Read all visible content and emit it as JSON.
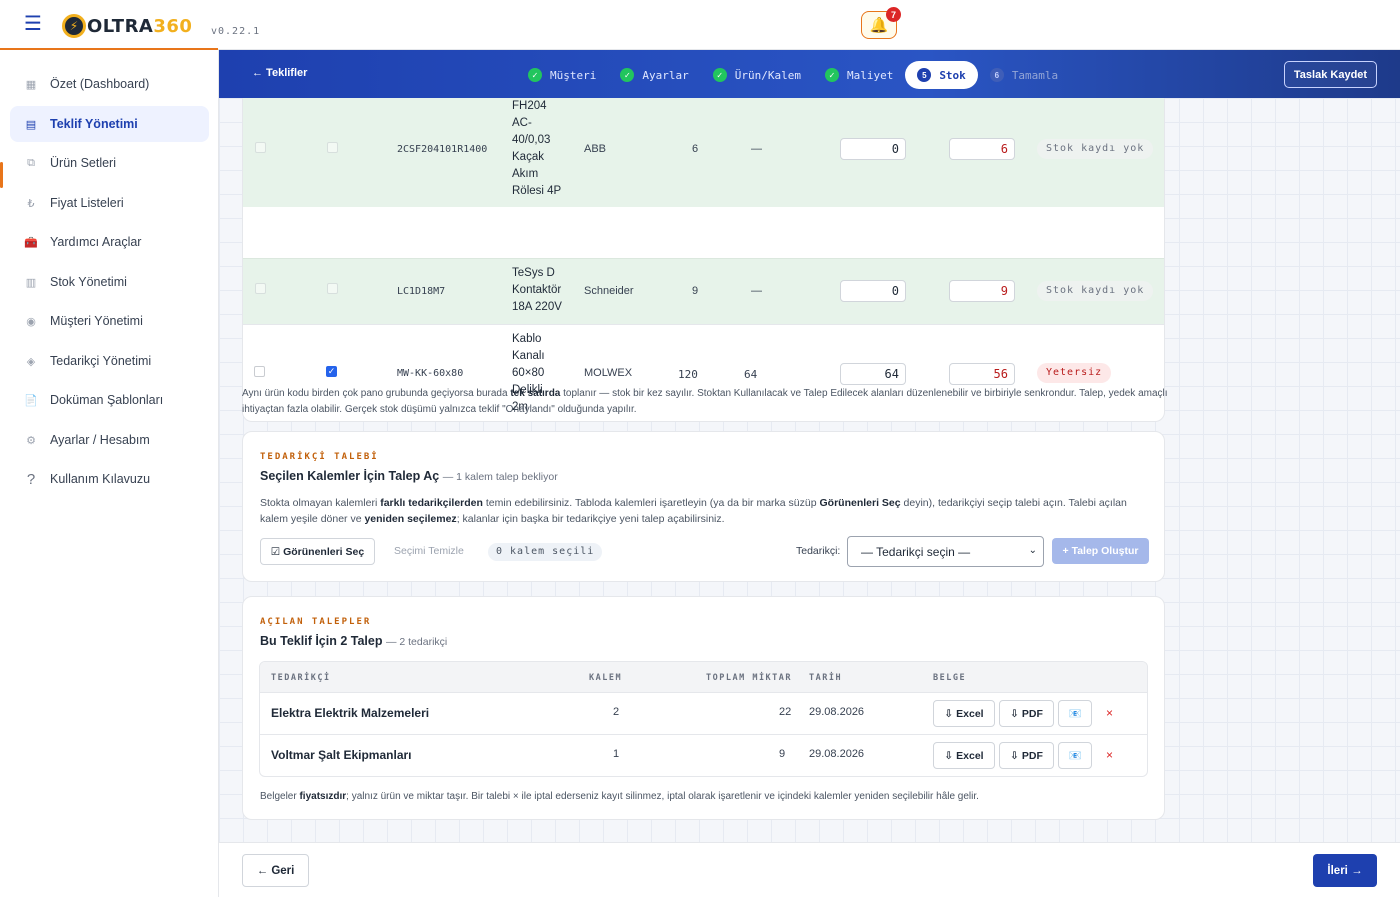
{
  "header": {
    "logo_prefix": "OLTRA",
    "logo_suffix": "360",
    "version": "v0.22.1",
    "notifications_count": "7"
  },
  "sidebar": {
    "items": [
      {
        "label": "Özet (Dashboard)",
        "icon": "dashboard-icon",
        "glyph": "▦"
      },
      {
        "label": "Teklif Yönetimi",
        "icon": "document-icon",
        "glyph": "▤"
      },
      {
        "label": "Ürün Setleri",
        "icon": "layers-icon",
        "glyph": "⧉"
      },
      {
        "label": "Fiyat Listeleri",
        "icon": "lira-icon",
        "glyph": "₺"
      },
      {
        "label": "Yardımcı Araçlar",
        "icon": "toolbox-icon",
        "glyph": "🧰"
      },
      {
        "label": "Stok Yönetimi",
        "icon": "warehouse-icon",
        "glyph": "▥"
      },
      {
        "label": "Müşteri Yönetimi",
        "icon": "customers-icon",
        "glyph": "◉"
      },
      {
        "label": "Tedarikçi Yönetimi",
        "icon": "supplier-icon",
        "glyph": "◈"
      },
      {
        "label": "Doküman Şablonları",
        "icon": "file-icon",
        "glyph": "📄"
      },
      {
        "label": "Ayarlar / Hesabım",
        "icon": "gear-icon",
        "glyph": "⚙"
      },
      {
        "label": "Kullanım Kılavuzu",
        "icon": "help-icon",
        "glyph": "?"
      }
    ]
  },
  "nav": {
    "back": "← Teklifler",
    "draft": "Taslak Kaydet",
    "steps": [
      {
        "label": "Müşteri",
        "marker": "✓",
        "state": "done"
      },
      {
        "label": "Ayarlar",
        "marker": "✓",
        "state": "done"
      },
      {
        "label": "Ürün/Kalem",
        "marker": "✓",
        "state": "done"
      },
      {
        "label": "Maliyet",
        "marker": "✓",
        "state": "done"
      },
      {
        "label": "Stok",
        "marker": "5",
        "state": "current"
      },
      {
        "label": "Tamamla",
        "marker": "6",
        "state": "todo"
      }
    ]
  },
  "products": {
    "rows": [
      {
        "code": "2CSF204101R1400",
        "name_lines": [
          "FH204",
          "AC-",
          "40/0,03",
          "Kaçak",
          "Akım",
          "Rölesi 4P"
        ],
        "brand": "ABB",
        "qty": "6",
        "stock": "—",
        "use_from_stock": "0",
        "request": "6",
        "status": "Stok kaydı yok",
        "status_kind": "none"
      },
      {
        "code": "LC1D18M7",
        "name_lines": [
          "TeSys D",
          "Kontaktör",
          "18A 220V"
        ],
        "brand": "Schneider",
        "qty": "9",
        "stock": "—",
        "use_from_stock": "0",
        "request": "9",
        "status": "Stok kaydı yok",
        "status_kind": "none"
      },
      {
        "code": "MW-KK-60x80",
        "name_lines": [
          "Kablo",
          "Kanalı",
          "60×80",
          "Delikli",
          "2m"
        ],
        "brand": "MOLWEX",
        "qty": "120",
        "stock": "64",
        "use_from_stock": "64",
        "request": "56",
        "status": "Yetersiz",
        "status_kind": "insufficient"
      }
    ]
  },
  "note": {
    "p1": "Aynı ürün kodu birden çok pano grubunda geçiyorsa burada ",
    "b1": "tek satırda",
    "p2": " toplanır — stok bir kez sayılır. Stoktan Kullanılacak ve Talep Edilecek alanları düzenlenebilir ve birbiriyle senkrondur. Talep, yedek amaçlı ihtiyaçtan fazla olabilir. Gerçek stok düşümü yalnızca teklif \"Onaylandı\" olduğunda yapılır."
  },
  "supplier_request": {
    "eyebrow": "TEDARİKÇİ TALEBİ",
    "title": "Seçilen Kalemler İçin Talep Aç",
    "subtitle": "— 1 kalem talep bekliyor",
    "desc_p1": "Stokta olmayan kalemleri ",
    "desc_b1": "farklı tedarikçilerden",
    "desc_p2": " temin edebilirsiniz. Tabloda kalemleri işaretleyin (ya da bir marka süzüp ",
    "desc_b2": "Görünenleri Seç",
    "desc_p3": " deyin), tedarikçiyi seçip talebi açın. Talebi açılan kalem yeşile döner ve ",
    "desc_b3": "yeniden seçilemez",
    "desc_p4": "; kalanlar için başka bir tedarikçiye yeni talep açabilirsiniz.",
    "select_visible": "☑ Görünenleri Seç",
    "clear_selection": "Seçimi Temizle",
    "selected_count": "0 kalem seçili",
    "supplier_label": "Tedarikçi:",
    "supplier_placeholder": "— Tedarikçi seçin —",
    "create": "+ Talep Oluştur"
  },
  "opened_requests": {
    "eyebrow": "AÇILAN TALEPLER",
    "title": "Bu Teklif İçin 2 Talep",
    "subtitle": "— 2 tedarikçi",
    "columns": [
      "TEDARİKÇİ",
      "KALEM",
      "TOPLAM MİKTAR",
      "TARİH",
      "BELGE"
    ],
    "rows": [
      {
        "supplier": "Elektra Elektrik Malzemeleri",
        "items": "2",
        "total": "22",
        "date": "29.08.2026"
      },
      {
        "supplier": "Voltmar Şalt Ekipmanları",
        "items": "1",
        "total": "9",
        "date": "29.08.2026"
      }
    ],
    "excel": "⇩ Excel",
    "pdf": "⇩ PDF",
    "mail": "📧",
    "delete": "×",
    "foot_p1": "Belgeler ",
    "foot_b1": "fiyatsızdır",
    "foot_p2": "; yalnız ürün ve miktar taşır. Bir talebi × ile iptal ederseniz kayıt silinmez, iptal olarak işaretlenir ve içindeki kalemler yeniden seçilebilir hâle gelir."
  },
  "footer": {
    "back": "← Geri",
    "next": "İleri →"
  },
  "colors": {
    "primary": "#1e40af",
    "accent": "#e8751a",
    "success": "#22c55e",
    "danger": "#dc2626",
    "linked_row": "#e7f3ea"
  }
}
